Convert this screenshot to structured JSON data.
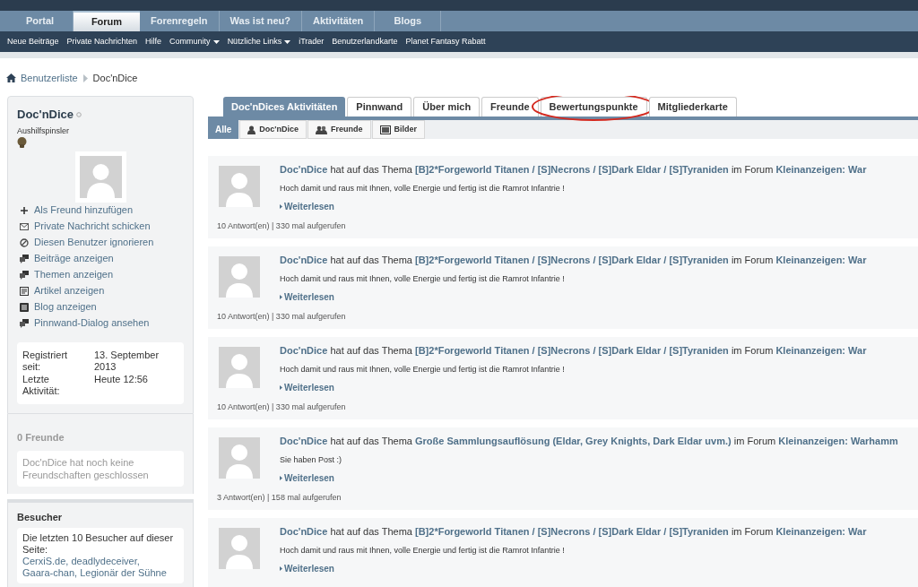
{
  "main_tabs": [
    {
      "label": "Portal",
      "selected": false
    },
    {
      "label": "Forum",
      "selected": true
    },
    {
      "label": "Forenregeln",
      "selected": false
    },
    {
      "label": "Was ist neu?",
      "selected": false
    },
    {
      "label": "Aktivitäten",
      "selected": false
    },
    {
      "label": "Blogs",
      "selected": false
    }
  ],
  "sub_nav": [
    {
      "label": "Neue Beiträge",
      "dropdown": false
    },
    {
      "label": "Private Nachrichten",
      "dropdown": false
    },
    {
      "label": "Hilfe",
      "dropdown": false
    },
    {
      "label": "Community",
      "dropdown": true
    },
    {
      "label": "Nützliche Links",
      "dropdown": true
    },
    {
      "label": "iTrader",
      "dropdown": false
    },
    {
      "label": "Benutzerlandkarte",
      "dropdown": false
    },
    {
      "label": "Planet Fantasy Rabatt",
      "dropdown": false
    }
  ],
  "breadcrumb": [
    "Benutzerliste",
    "Doc'nDice"
  ],
  "profile": {
    "name": "Doc'nDice",
    "rank": "Aushilfspinsler",
    "actions": [
      {
        "kind": "add",
        "label": "Als Freund hinzufügen"
      },
      {
        "kind": "message",
        "label": "Private Nachricht schicken"
      },
      {
        "kind": "ignore",
        "label": "Diesen Benutzer ignorieren"
      },
      {
        "kind": "posts",
        "label": "Beiträge anzeigen"
      },
      {
        "kind": "posts",
        "label": "Themen anzeigen"
      },
      {
        "kind": "article",
        "label": "Artikel anzeigen"
      },
      {
        "kind": "blog",
        "label": "Blog anzeigen"
      },
      {
        "kind": "posts",
        "label": "Pinnwand-Dialog ansehen"
      }
    ],
    "stats": [
      {
        "label": "Registriert seit:",
        "value": "13. September 2013"
      },
      {
        "label": "Letzte Aktivität:",
        "value": "Heute 12:56"
      }
    ]
  },
  "friends": {
    "title": "0 Freunde",
    "text": "Doc'nDice hat noch keine Freundschaften geschlossen"
  },
  "visitors": {
    "title": "Besucher",
    "text": "Die letzten 10 Besucher auf dieser Seite:",
    "names": "CerxiS.de, deadlydeceiver,",
    "names_2": "Gaara-chan, Legionär der Sühne"
  },
  "profile_tabs": [
    {
      "label": "Doc'nDices Aktivitäten",
      "selected": true,
      "circled": false
    },
    {
      "label": "Pinnwand",
      "selected": false,
      "circled": false
    },
    {
      "label": "Über mich",
      "selected": false,
      "circled": false
    },
    {
      "label": "Freunde",
      "selected": false,
      "circled": false
    },
    {
      "label": "Bewertungspunkte",
      "selected": false,
      "circled": true
    },
    {
      "label": "Mitgliederkarte",
      "selected": false,
      "circled": false
    }
  ],
  "filters": [
    {
      "label": "Alle",
      "kind": "all",
      "selected": true
    },
    {
      "label": "Doc'nDice",
      "kind": "user",
      "selected": false
    },
    {
      "label": "Freunde",
      "kind": "group",
      "selected": false
    },
    {
      "label": "Bilder",
      "kind": "image",
      "selected": false
    }
  ],
  "activities": [
    {
      "title": [
        {
          "text": "Doc'nDice",
          "kind": "link"
        },
        {
          "text": " hat auf das Thema ",
          "kind": "plain"
        },
        {
          "text": "[B]2*Forgeworld Titanen / [S]Necrons / [S]Dark Eldar / [S]Tyraniden",
          "kind": "link"
        },
        {
          "text": " im Forum ",
          "kind": "plain"
        },
        {
          "text": "Kleinanzeigen: War",
          "kind": "link"
        }
      ],
      "snippet": "Hoch damit und raus mit Ihnen, volle Energie und fertig ist die Ramrot Infantrie !",
      "more": "Weiterlesen",
      "stats": "10 Antwort(en) | 330 mal aufgerufen"
    },
    {
      "title": [
        {
          "text": "Doc'nDice",
          "kind": "link"
        },
        {
          "text": " hat auf das Thema ",
          "kind": "plain"
        },
        {
          "text": "[B]2*Forgeworld Titanen / [S]Necrons / [S]Dark Eldar / [S]Tyraniden",
          "kind": "link"
        },
        {
          "text": " im Forum ",
          "kind": "plain"
        },
        {
          "text": "Kleinanzeigen: War",
          "kind": "link"
        }
      ],
      "snippet": "Hoch damit und raus mit Ihnen, volle Energie und fertig ist die Ramrot Infantrie !",
      "more": "Weiterlesen",
      "stats": "10 Antwort(en) | 330 mal aufgerufen"
    },
    {
      "title": [
        {
          "text": "Doc'nDice",
          "kind": "link"
        },
        {
          "text": " hat auf das Thema ",
          "kind": "plain"
        },
        {
          "text": "[B]2*Forgeworld Titanen / [S]Necrons / [S]Dark Eldar / [S]Tyraniden",
          "kind": "link"
        },
        {
          "text": " im Forum ",
          "kind": "plain"
        },
        {
          "text": "Kleinanzeigen: War",
          "kind": "link"
        }
      ],
      "snippet": "Hoch damit und raus mit Ihnen, volle Energie und fertig ist die Ramrot Infantrie !",
      "more": "Weiterlesen",
      "stats": "10 Antwort(en) | 330 mal aufgerufen"
    },
    {
      "title": [
        {
          "text": "Doc'nDice",
          "kind": "link"
        },
        {
          "text": " hat auf das Thema ",
          "kind": "plain"
        },
        {
          "text": "Große Sammlungsauflösung (Eldar, Grey Knights, Dark Eldar uvm.)",
          "kind": "link"
        },
        {
          "text": " im Forum ",
          "kind": "plain"
        },
        {
          "text": "Kleinanzeigen: Warhamm",
          "kind": "link"
        }
      ],
      "snippet": "Sie haben Post :)",
      "more": "Weiterlesen",
      "stats": "3 Antwort(en) | 158 mal aufgerufen"
    },
    {
      "title": [
        {
          "text": "Doc'nDice",
          "kind": "link"
        },
        {
          "text": " hat auf das Thema ",
          "kind": "plain"
        },
        {
          "text": "[B]2*Forgeworld Titanen / [S]Necrons / [S]Dark Eldar / [S]Tyraniden",
          "kind": "link"
        },
        {
          "text": " im Forum ",
          "kind": "plain"
        },
        {
          "text": "Kleinanzeigen: War",
          "kind": "link"
        }
      ],
      "snippet": "Hoch damit und raus mit Ihnen, volle Energie und fertig ist die Ramrot Infantrie !",
      "more": "Weiterlesen"
    }
  ]
}
